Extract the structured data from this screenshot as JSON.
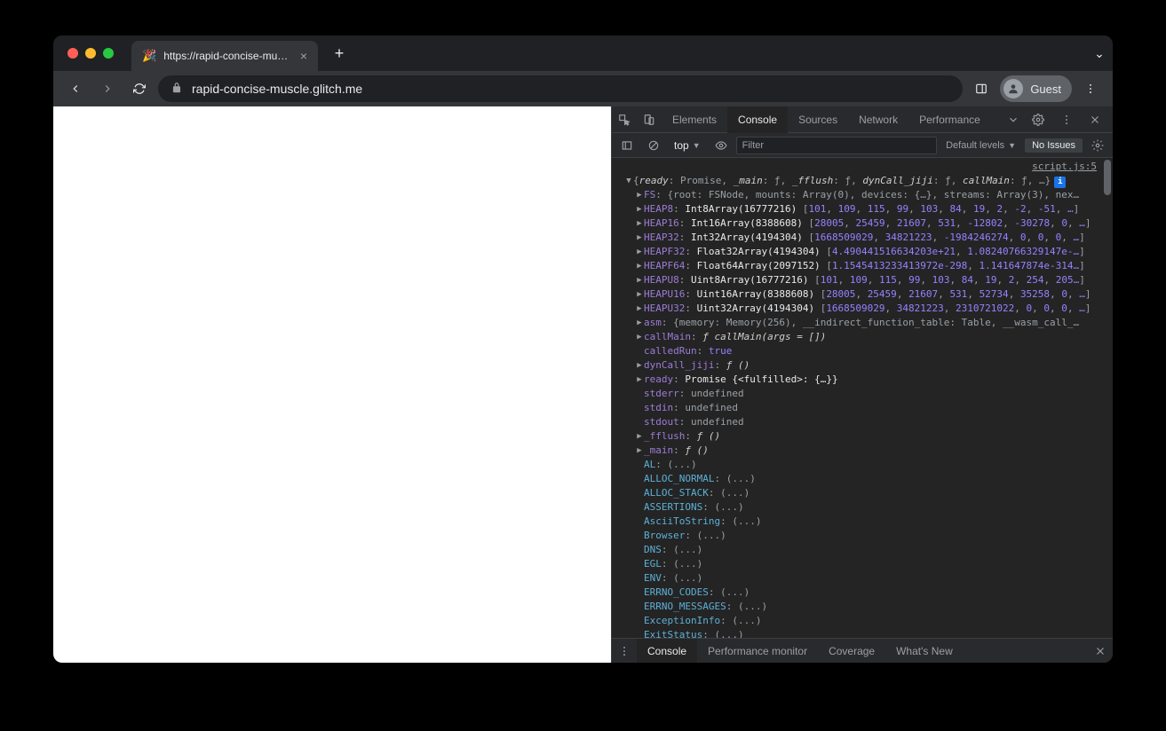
{
  "tab": {
    "title": "https://rapid-concise-muscle.g",
    "favicon": "🎉"
  },
  "toolbar": {
    "url": "rapid-concise-muscle.glitch.me",
    "guest_label": "Guest"
  },
  "devtools": {
    "tabs": [
      "Elements",
      "Console",
      "Sources",
      "Network",
      "Performance"
    ],
    "active_tab": "Console",
    "console_toolbar": {
      "context": "top",
      "filter_placeholder": "Filter",
      "levels_label": "Default levels",
      "issues_label": "No Issues"
    },
    "source_link": "script.js:5",
    "drawer": {
      "tabs": [
        "Console",
        "Performance monitor",
        "Coverage",
        "What's New"
      ],
      "active": "Console"
    }
  },
  "obj": {
    "summary": "{ready: Promise, _main: ƒ, _fflush: ƒ, dynCall_jiji: ƒ, callMain: ƒ, …}",
    "props": [
      {
        "key": "FS",
        "kind": "obj",
        "preview": "{root: FSNode, mounts: Array(0), devices: {…}, streams: Array(3), nex…"
      },
      {
        "key": "HEAP8",
        "kind": "typed",
        "type": "Int8Array(16777216)",
        "vals": [
          "101",
          "109",
          "115",
          "99",
          "103",
          "84",
          "19",
          "2",
          "-2",
          "-51",
          "…"
        ]
      },
      {
        "key": "HEAP16",
        "kind": "typed",
        "type": "Int16Array(8388608)",
        "vals": [
          "28005",
          "25459",
          "21607",
          "531",
          "-12802",
          "-30278",
          "0",
          "…"
        ]
      },
      {
        "key": "HEAP32",
        "kind": "typed",
        "type": "Int32Array(4194304)",
        "vals": [
          "1668509029",
          "34821223",
          "-1984246274",
          "0",
          "0",
          "0",
          "…"
        ]
      },
      {
        "key": "HEAPF32",
        "kind": "typed",
        "type": "Float32Array(4194304)",
        "vals": [
          "4.490441516634203e+21",
          "1.08240766329147e-…"
        ]
      },
      {
        "key": "HEAPF64",
        "kind": "typed",
        "type": "Float64Array(2097152)",
        "vals": [
          "1.1545413233413972e-298",
          "1.141647874e-314…"
        ]
      },
      {
        "key": "HEAPU8",
        "kind": "typed",
        "type": "Uint8Array(16777216)",
        "vals": [
          "101",
          "109",
          "115",
          "99",
          "103",
          "84",
          "19",
          "2",
          "254",
          "205…"
        ]
      },
      {
        "key": "HEAPU16",
        "kind": "typed",
        "type": "Uint16Array(8388608)",
        "vals": [
          "28005",
          "25459",
          "21607",
          "531",
          "52734",
          "35258",
          "0",
          "…"
        ]
      },
      {
        "key": "HEAPU32",
        "kind": "typed",
        "type": "Uint32Array(4194304)",
        "vals": [
          "1668509029",
          "34821223",
          "2310721022",
          "0",
          "0",
          "0",
          "…"
        ]
      },
      {
        "key": "asm",
        "kind": "obj",
        "preview": "{memory: Memory(256), __indirect_function_table: Table, __wasm_call_…"
      },
      {
        "key": "callMain",
        "kind": "fn",
        "sig": "ƒ callMain(args = [])"
      },
      {
        "key": "calledRun",
        "kind": "bool",
        "val": "true",
        "noarrow": true
      },
      {
        "key": "dynCall_jiji",
        "kind": "fn",
        "sig": "ƒ ()"
      },
      {
        "key": "ready",
        "kind": "promise",
        "preview": "Promise {<fulfilled>: {…}}"
      },
      {
        "key": "stderr",
        "kind": "undef",
        "noarrow": true
      },
      {
        "key": "stdin",
        "kind": "undef",
        "noarrow": true
      },
      {
        "key": "stdout",
        "kind": "undef",
        "noarrow": true
      },
      {
        "key": "_fflush",
        "kind": "fn",
        "sig": "ƒ ()"
      },
      {
        "key": "_main",
        "kind": "fn",
        "sig": "ƒ ()"
      },
      {
        "key": "AL",
        "kind": "getter",
        "noarrow": true
      },
      {
        "key": "ALLOC_NORMAL",
        "kind": "getter",
        "noarrow": true
      },
      {
        "key": "ALLOC_STACK",
        "kind": "getter",
        "noarrow": true
      },
      {
        "key": "ASSERTIONS",
        "kind": "getter",
        "noarrow": true
      },
      {
        "key": "AsciiToString",
        "kind": "getter",
        "noarrow": true
      },
      {
        "key": "Browser",
        "kind": "getter",
        "noarrow": true
      },
      {
        "key": "DNS",
        "kind": "getter",
        "noarrow": true
      },
      {
        "key": "EGL",
        "kind": "getter",
        "noarrow": true
      },
      {
        "key": "ENV",
        "kind": "getter",
        "noarrow": true
      },
      {
        "key": "ERRNO_CODES",
        "kind": "getter",
        "noarrow": true
      },
      {
        "key": "ERRNO_MESSAGES",
        "kind": "getter",
        "noarrow": true
      },
      {
        "key": "ExceptionInfo",
        "kind": "getter",
        "noarrow": true
      },
      {
        "key": "ExitStatus",
        "kind": "getter",
        "noarrow": true
      }
    ]
  }
}
